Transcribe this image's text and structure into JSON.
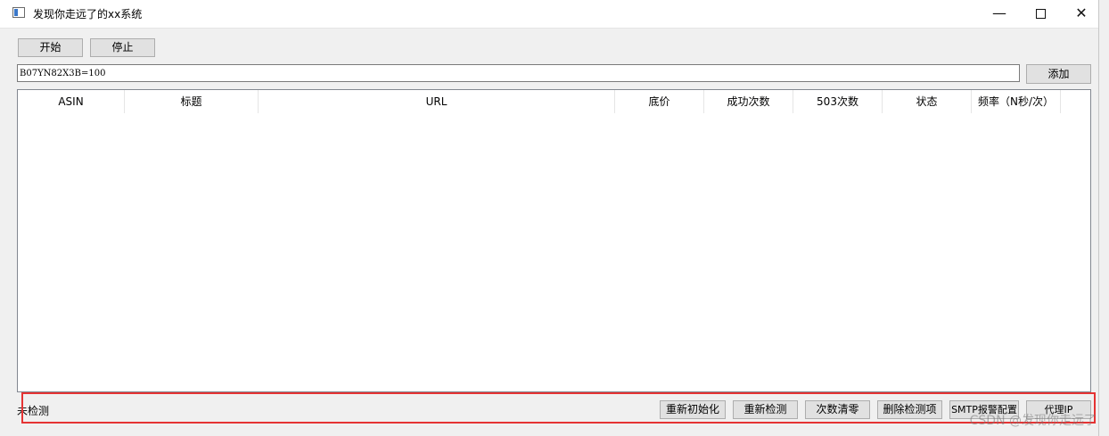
{
  "window": {
    "title": "发现你走远了的xx系统",
    "minimize_glyph": "—",
    "close_glyph": "✕"
  },
  "toolbar": {
    "start_label": "开始",
    "stop_label": "停止"
  },
  "input": {
    "value": "B07YN82X3B=100",
    "add_label": "添加"
  },
  "table": {
    "columns": [
      "ASIN",
      "标题",
      "URL",
      "底价",
      "成功次数",
      "503次数",
      "状态",
      "频率（N秒/次）"
    ],
    "rows": []
  },
  "statusbar": {
    "status_text": "未检测",
    "buttons": [
      "重新初始化",
      "重新检测",
      "次数清零",
      "删除检测项",
      "SMTP报警配置",
      "代理IP"
    ]
  },
  "watermark": {
    "text": "CSDN @发现你走远了"
  },
  "colors": {
    "background": "#f0f0f0",
    "button_bg": "#e1e1e1",
    "highlight_border": "#e53333"
  }
}
